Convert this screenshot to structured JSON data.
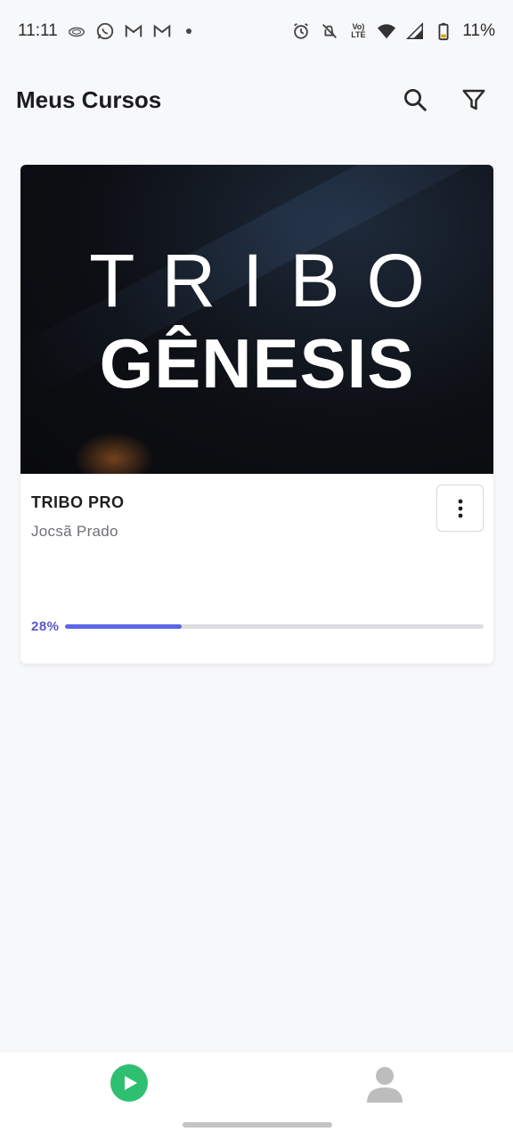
{
  "status_bar": {
    "time": "11:11",
    "battery": "11%",
    "icons_left": [
      "cloud-icon",
      "whatsapp-icon",
      "gmail-icon",
      "gmail-icon",
      "dot-icon"
    ],
    "icons_right": [
      "alarm-icon",
      "mute-icon",
      "volte-icon",
      "wifi-icon",
      "signal-icon",
      "battery-icon"
    ],
    "volte_label_top": "Vo)",
    "volte_label_bottom": "LTE"
  },
  "header": {
    "title": "Meus Cursos",
    "actions": [
      "search-icon",
      "filter-icon"
    ]
  },
  "course": {
    "cover_line1": "TRIBO",
    "cover_line2": "GÊNESIS",
    "name": "TRIBO PRO",
    "author": "Jocsã Prado",
    "progress_label": "28%",
    "progress_value": 0.28,
    "progress_fill_width_fraction": 0.28,
    "accent_color": "#5c67e6"
  },
  "bottom_nav": {
    "items": [
      "play-icon",
      "profile-icon"
    ],
    "active_color": "#2fbf71"
  }
}
